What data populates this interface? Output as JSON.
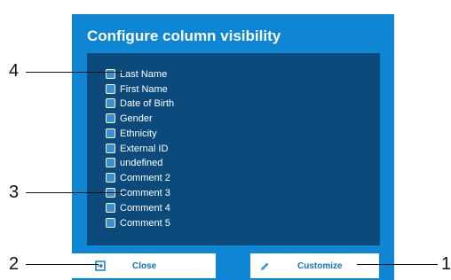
{
  "dialog": {
    "title": "Configure column visibility",
    "columns": [
      {
        "label": "Last Name",
        "checked": false
      },
      {
        "label": "First Name",
        "checked": false
      },
      {
        "label": "Date of Birth",
        "checked": false
      },
      {
        "label": "Gender",
        "checked": false
      },
      {
        "label": "Ethnicity",
        "checked": false
      },
      {
        "label": "External ID",
        "checked": false
      },
      {
        "label": "undefined",
        "checked": false
      },
      {
        "label": "Comment 2",
        "checked": false
      },
      {
        "label": "Comment 3",
        "checked": false
      },
      {
        "label": "Comment 4",
        "checked": false
      },
      {
        "label": "Comment 5",
        "checked": false
      }
    ],
    "close_label": "Close",
    "customize_label": "Customize"
  },
  "callouts": {
    "c1": "1",
    "c2": "2",
    "c3": "3",
    "c4": "4"
  },
  "colors": {
    "dialog_bg": "#0e86d4",
    "panel_bg": "#0b4a7b",
    "button_text": "#0d74c2"
  },
  "icons": {
    "close": "exit-icon",
    "customize": "pencil-icon"
  }
}
